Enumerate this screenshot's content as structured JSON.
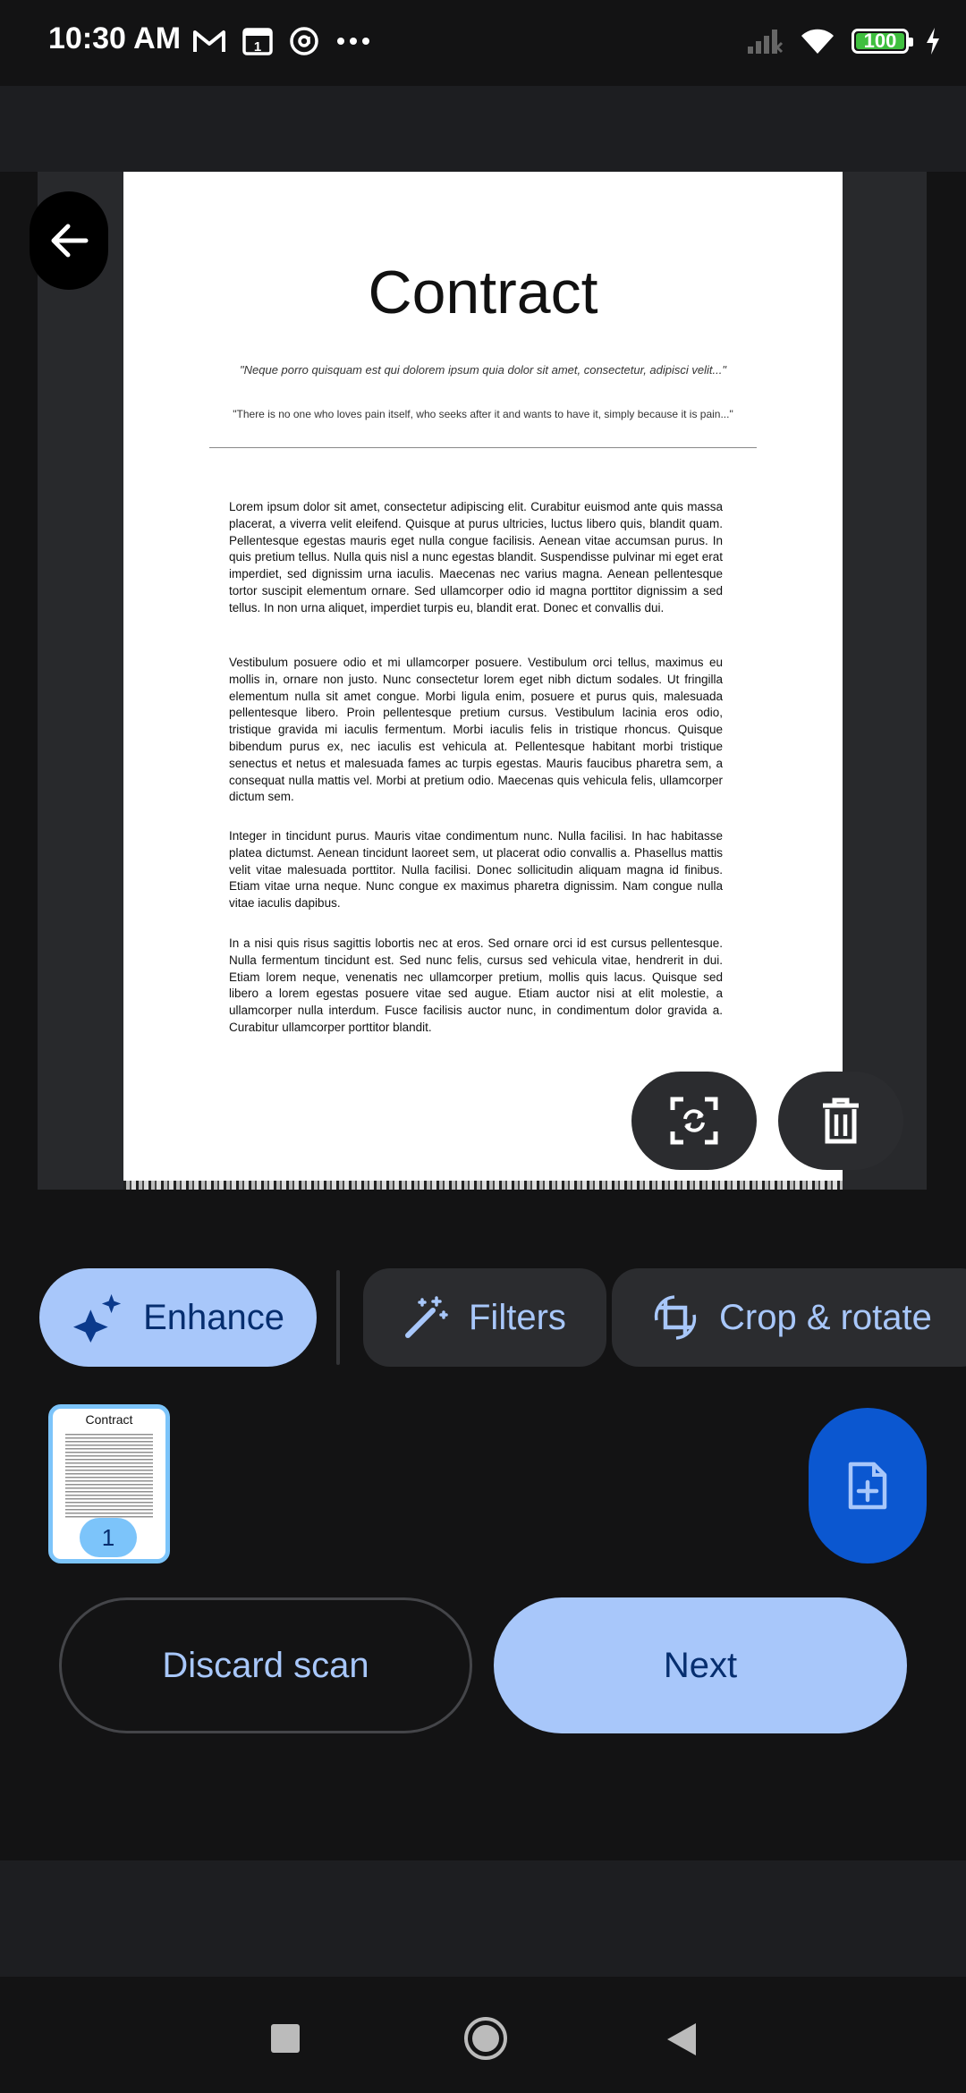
{
  "status_bar": {
    "time": "10:30 AM",
    "battery": "100",
    "battery_level_pct": 100
  },
  "document": {
    "title": "Contract",
    "quote1": "\"Neque porro quisquam est qui dolorem ipsum quia dolor sit amet, consectetur, adipisci velit...\"",
    "quote2": "\"There is no one who loves pain itself, who seeks after it and wants to have it, simply because it is pain...\"",
    "paragraphs": [
      "Lorem ipsum dolor sit amet, consectetur adipiscing elit. Curabitur euismod ante quis massa placerat, a viverra velit eleifend. Quisque at purus ultricies, luctus libero quis, blandit quam. Pellentesque egestas mauris eget nulla congue facilisis. Aenean vitae accumsan purus. In quis pretium tellus. Nulla quis nisl a nunc egestas blandit. Suspendisse pulvinar mi eget erat imperdiet, sed dignissim urna iaculis. Maecenas nec varius magna. Aenean pellentesque tortor suscipit elementum ornare. Sed ullamcorper odio id magna porttitor dignissim a sed tellus. In non urna aliquet, imperdiet turpis eu, blandit erat. Donec et convallis dui.",
      "Vestibulum posuere odio et mi ullamcorper posuere. Vestibulum orci tellus, maximus eu mollis in, ornare non justo. Nunc consectetur lorem eget nibh dictum sodales. Ut fringilla elementum nulla sit amet congue. Morbi ligula enim, posuere et purus quis, malesuada pellentesque libero. Proin pellentesque pretium cursus. Vestibulum lacinia eros odio, tristique gravida mi iaculis fermentum. Morbi iaculis felis in tristique rhoncus. Quisque bibendum purus ex, nec iaculis est vehicula at. Pellentesque habitant morbi tristique senectus et netus et malesuada fames ac turpis egestas. Mauris faucibus pharetra sem, a consequat nulla mattis vel. Morbi at pretium odio. Maecenas quis vehicula felis, ullamcorper dictum sem.",
      "Integer in tincidunt purus. Mauris vitae condimentum nunc. Nulla facilisi. In hac habitasse platea dictumst. Aenean tincidunt laoreet sem, ut placerat odio convallis a. Phasellus mattis velit vitae malesuada porttitor. Nulla facilisi. Donec sollicitudin aliquam magna id finibus. Etiam vitae urna neque. Nunc congue ex maximus pharetra dignissim. Nam congue nulla vitae iaculis dapibus.",
      "In a nisi quis risus sagittis lobortis nec at eros. Sed ornare orci id est cursus pellentesque. Nulla fermentum tincidunt est. Sed nunc felis, cursus sed vehicula vitae, hendrerit in dui. Etiam lorem neque, venenatis nec ullamcorper pretium, mollis quis lacus. Quisque sed libero a lorem egestas posuere vitae sed augue. Etiam auctor nisi at elit molestie, a ullamcorper nulla interdum. Fusce facilisis auctor nunc, in condimentum dolor gravida a. Curabitur ullamcorper porttitor blandit."
    ]
  },
  "tools": {
    "enhance": "Enhance",
    "filters": "Filters",
    "crop_rotate": "Crop & rotate"
  },
  "thumbnail": {
    "title": "Contract",
    "page_number": "1"
  },
  "actions": {
    "discard": "Discard scan",
    "next": "Next"
  },
  "colors": {
    "accent": "#a8c7fa",
    "accent_text": "#062e6f",
    "surface": "#2b2c2f",
    "background": "#131314",
    "fab": "#0b57d0",
    "selection": "#7cc4fa"
  },
  "icons": {
    "back": "arrow-left-icon",
    "retake": "retake-scan-icon",
    "delete": "trash-icon",
    "enhance": "sparkle-icon",
    "filters": "magic-wand-icon",
    "crop": "crop-rotate-icon",
    "add_page": "add-page-icon"
  }
}
